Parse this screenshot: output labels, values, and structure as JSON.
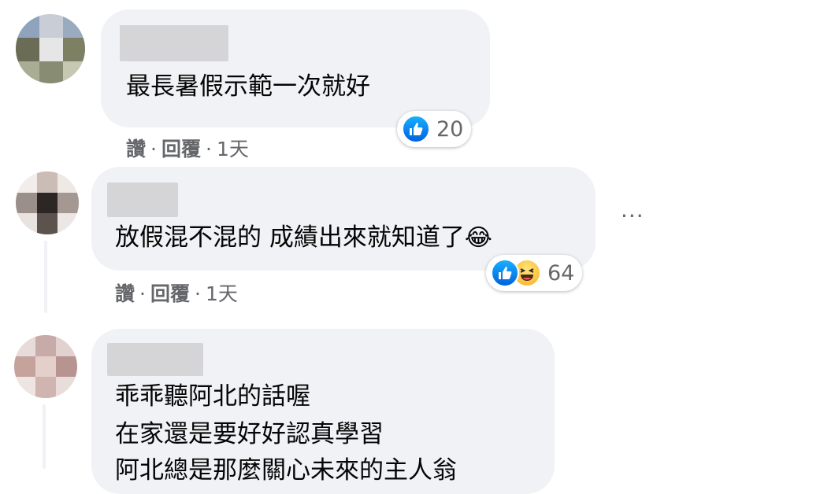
{
  "comments": [
    {
      "text": "最長暑假示範一次就好",
      "actions": {
        "like": "讚",
        "reply": "回覆",
        "time": "1天",
        "sep": "·"
      },
      "reactions": {
        "types": [
          "like"
        ],
        "count": "20"
      }
    },
    {
      "text": "放假混不混的 成績出來就知道了",
      "emoji": "😂",
      "actions": {
        "like": "讚",
        "reply": "回覆",
        "time": "1天",
        "sep": "·"
      },
      "reactions": {
        "types": [
          "like",
          "haha"
        ],
        "count": "64"
      }
    },
    {
      "lines": [
        "乖乖聽阿北的話喔",
        "在家還是要好好認真學習",
        "阿北總是那麼關心未來的主人翁"
      ]
    }
  ],
  "more_menu": "···",
  "colors": {
    "bubble": "#f0f2f5",
    "meta": "#65676b",
    "like_blue": "#0571ed",
    "haha_yellow": "#f7b125"
  },
  "icons": [
    "like-reaction-icon",
    "haha-reaction-icon",
    "more-options-icon"
  ]
}
